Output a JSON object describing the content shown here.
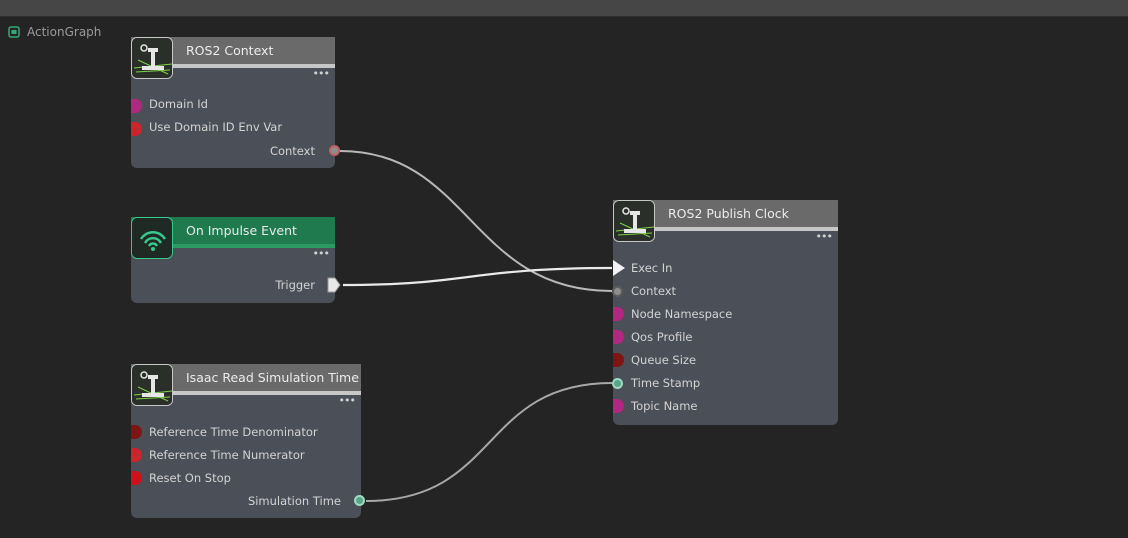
{
  "graph_title": "ActionGraph",
  "icons": {
    "graph": "action-graph-icon",
    "robot": "ros-robot-icon",
    "impulse": "wifi-signal-icon",
    "more": "more-dots-icon"
  },
  "colors": {
    "background": "#242424",
    "node_body": "#4b4f57",
    "node_header": "#6a6a6a",
    "impulse_header": "#1f7a4e",
    "pin_magenta": "#b0287f",
    "pin_red": "#c8262a",
    "pin_darkred": "#7e1515",
    "pin_gray": "#8d8d8d",
    "pin_teal": "#5aa58a",
    "wire": "#c8c8c8"
  },
  "nodes": {
    "ros2_context": {
      "title": "ROS2 Context",
      "inputs": [
        "Domain Id",
        "Use Domain ID Env Var"
      ],
      "outputs": [
        "Context"
      ]
    },
    "on_impulse": {
      "title": "On Impulse Event",
      "outputs": [
        "Trigger"
      ]
    },
    "read_sim_time": {
      "title": "Isaac Read Simulation Time",
      "inputs": [
        "Reference Time Denominator",
        "Reference Time Numerator",
        "Reset On Stop"
      ],
      "outputs": [
        "Simulation Time"
      ]
    },
    "publish_clock": {
      "title": "ROS2 Publish Clock",
      "inputs": [
        "Exec In",
        "Context",
        "Node Namespace",
        "Qos Profile",
        "Queue Size",
        "Time Stamp",
        "Topic Name"
      ]
    }
  }
}
